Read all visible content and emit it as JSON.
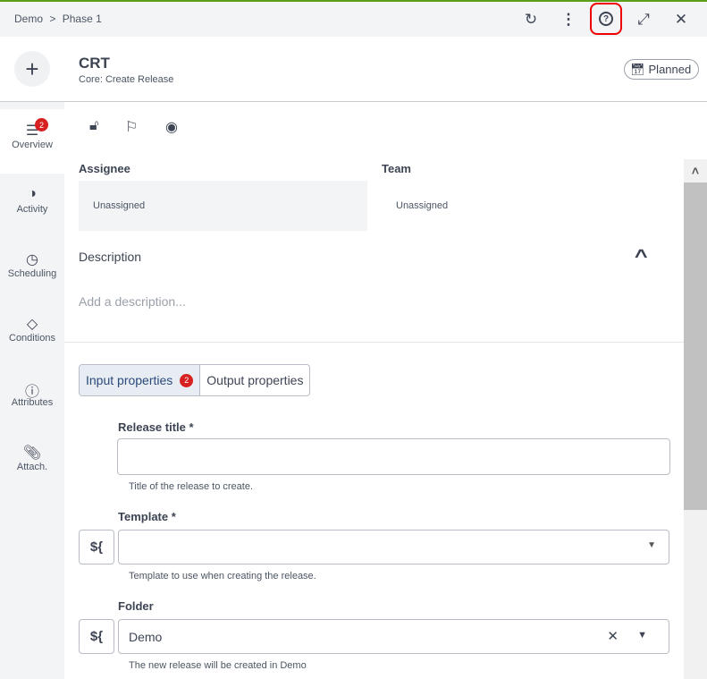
{
  "breadcrumb": {
    "items": [
      "Demo",
      "Phase 1"
    ],
    "separator": ">"
  },
  "toolbar": {
    "refresh": "refresh-icon",
    "more": "more-vertical-icon",
    "help": "help-circle-icon",
    "expand": "expand-icon",
    "close": "close-icon"
  },
  "header": {
    "add_icon": "plus-icon",
    "title": "CRT",
    "subtitle": "Core: Create Release",
    "status": "Planned"
  },
  "sidebar": {
    "items": [
      {
        "label": "Overview",
        "badge": "2",
        "active": true
      },
      {
        "label": "Activity"
      },
      {
        "label": "Scheduling"
      },
      {
        "label": "Conditions"
      },
      {
        "label": "Attributes"
      },
      {
        "label": "Attach."
      }
    ]
  },
  "main": {
    "assignee_label": "Assignee",
    "assignee_value": "Unassigned",
    "team_label": "Team",
    "team_value": "Unassigned",
    "description_label": "Description",
    "description_placeholder": "Add a description...",
    "tabs": [
      {
        "label": "Input properties",
        "badge": "2",
        "active": true
      },
      {
        "label": "Output properties"
      }
    ],
    "fields": [
      {
        "label": "Release title *",
        "value": "",
        "hint": "Title of the release to create."
      },
      {
        "label": "Template *",
        "value": "",
        "hint": "Template to use when creating the release.",
        "variable_button": "${"
      },
      {
        "label": "Folder",
        "value": "Demo",
        "hint": "The new release will be created in Demo",
        "variable_button": "${"
      }
    ]
  },
  "colors": {
    "accent_green": "#5a9e1a",
    "badge_red": "#d72020",
    "highlight": "#e00000"
  }
}
